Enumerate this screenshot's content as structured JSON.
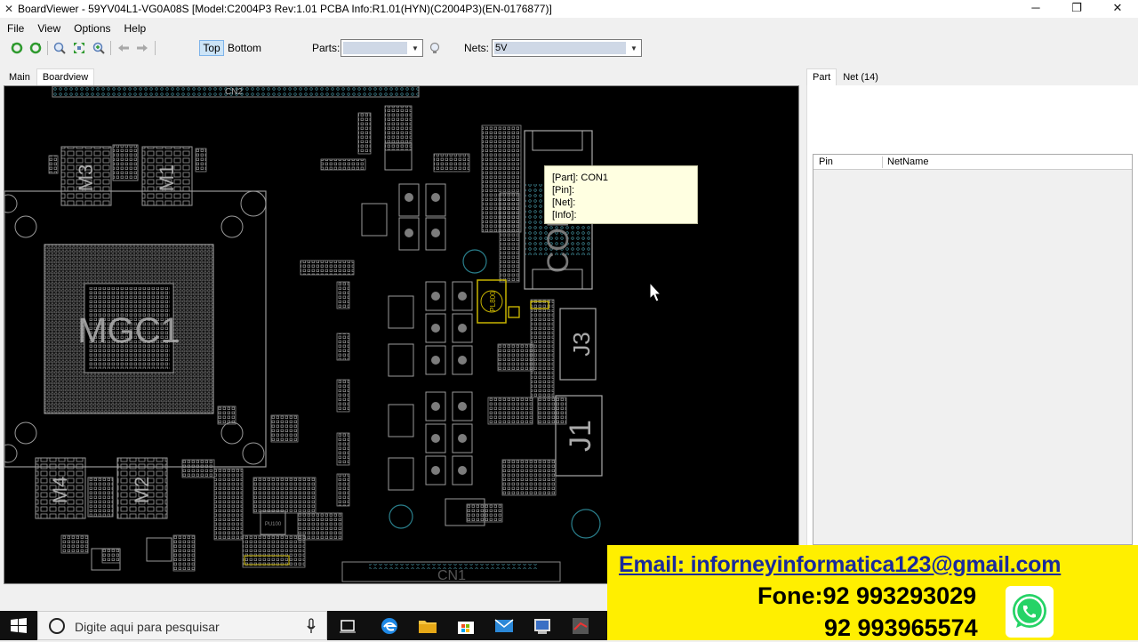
{
  "window": {
    "title": "BoardViewer - 59YV04L1-VG0A08S [Model:C2004P3 Rev:1.01 PCBA Info:R1.01(HYN)(C2004P3)(EN-0176877)]",
    "minimize": "─",
    "restore": "❐",
    "close": "✕"
  },
  "menu": [
    "File",
    "View",
    "Options",
    "Help"
  ],
  "toolbar": {
    "top_label": "Top",
    "bottom_label": "Bottom",
    "parts_label": "Parts:",
    "parts_value": "",
    "nets_label": "Nets:",
    "nets_value": "5V"
  },
  "tabs_left": [
    "Main",
    "Boardview"
  ],
  "tabs_right": [
    "Part",
    "Net (14)"
  ],
  "board": {
    "labels": [
      "CN2",
      "M3",
      "M1",
      "MGC1",
      "M4",
      "M2",
      "CON1",
      "J3",
      "J1",
      "CN1",
      "PL800",
      "PU100"
    ]
  },
  "tooltip": {
    "part": "[Part]: CON1",
    "pin": "[Pin]:",
    "net": "[Net]:",
    "info": "[Info]:"
  },
  "pin_grid": {
    "columns": [
      "Pin",
      "NetName"
    ]
  },
  "taskbar": {
    "search_placeholder": "Digite aqui para pesquisar"
  },
  "banner": {
    "email": "Email: inforneyinformatica123@gmail.com",
    "phone1": "Fone:92 993293029",
    "phone2": "92 993965574"
  }
}
